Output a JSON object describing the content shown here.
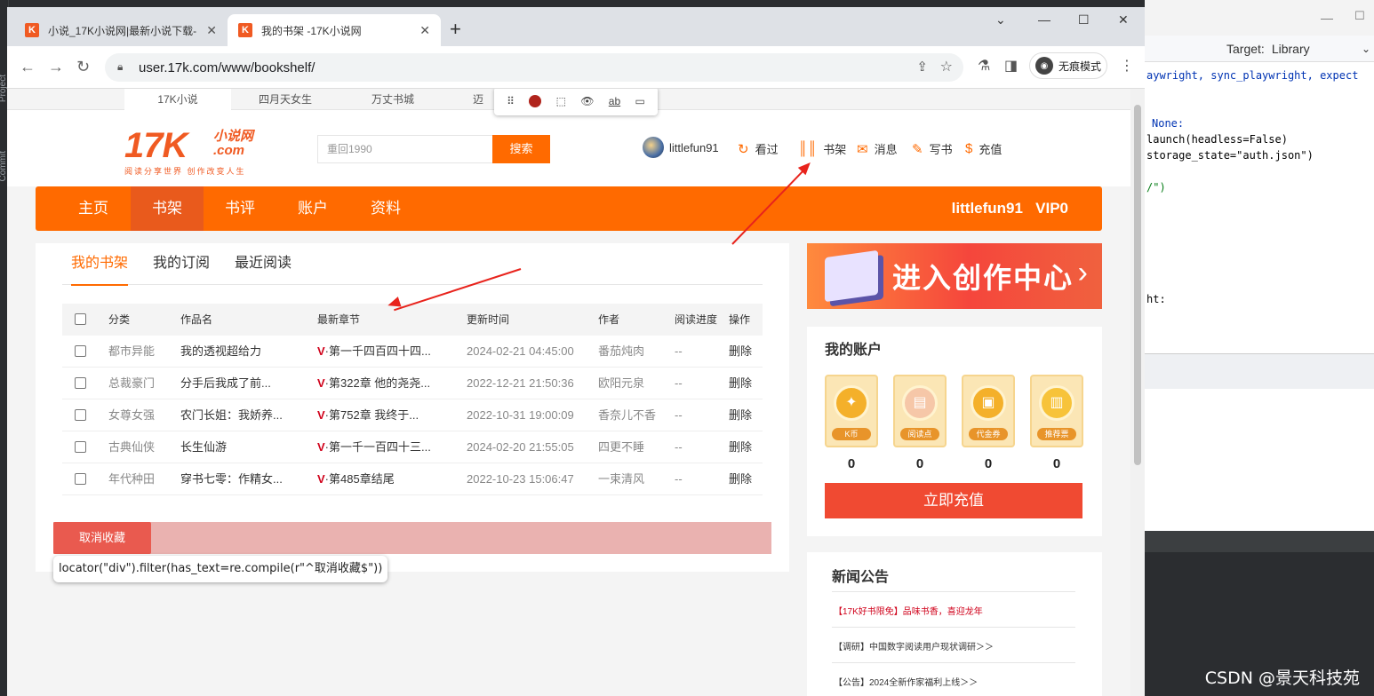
{
  "ide": {
    "left_labels": [
      "Project",
      "Commit"
    ],
    "target_label": "Target:",
    "target_value": "Library",
    "code_lines": [
      {
        "text": "aywright, sync_playwright, expect"
      },
      {
        "text": "None:"
      },
      {
        "text": "launch(headless=False)"
      },
      {
        "text": "storage_state=\"auth.json\")"
      },
      {
        "text": "/\")"
      },
      {
        "text": "ht:"
      }
    ]
  },
  "watermark": "CSDN @景天科技苑",
  "browser": {
    "tabs": [
      {
        "title": "小说_17K小说网|最新小说下载-",
        "favicon": "K"
      },
      {
        "title": "我的书架 -17K小说网",
        "favicon": "K"
      }
    ],
    "url": "user.17k.com/www/bookshelf/",
    "incognito_label": "无痕模式"
  },
  "site_tabs": [
    "17K小说",
    "四月天女生",
    "万丈书城",
    "迈"
  ],
  "playwright_toolbar": {
    "icons": [
      "drag-icon",
      "record-icon",
      "pick-locator-icon",
      "assert-visibility-icon",
      "assert-text-icon",
      "assert-value-icon"
    ]
  },
  "header": {
    "logo_main": "17K",
    "logo_suffix_top": "小说网",
    "logo_suffix_bottom": ".com",
    "slogan": "阅读分享世界 创作改变人生",
    "search_placeholder": "重回1990",
    "search_button": "搜索",
    "username": "littlefun91",
    "links": [
      "看过",
      "书架",
      "消息",
      "写书",
      "充值"
    ]
  },
  "main_nav": {
    "items": [
      "主页",
      "书架",
      "书评",
      "账户",
      "资料"
    ],
    "active": "书架",
    "user": "littlefun91",
    "vip": "VIP0"
  },
  "shelf": {
    "tabs": [
      "我的书架",
      "我的订阅",
      "最近阅读"
    ],
    "active_tab": "我的书架",
    "columns": [
      "分类",
      "作品名",
      "最新章节",
      "更新时间",
      "作者",
      "阅读进度",
      "操作"
    ],
    "rows": [
      {
        "category": "都市异能",
        "title": "我的透视超给力",
        "vtag": "V",
        "chapter": "·第一千四百四十四...",
        "updated": "2024-02-21 04:45:00",
        "author": "番茄炖肉",
        "progress": "--",
        "action": "删除"
      },
      {
        "category": "总裁豪门",
        "title": "分手后我成了前...",
        "vtag": "V",
        "chapter": "·第322章 他的尧尧...",
        "updated": "2022-12-21 21:50:36",
        "author": "欧阳元泉",
        "progress": "--",
        "action": "删除"
      },
      {
        "category": "女尊女强",
        "title": "农门长姐：我娇养...",
        "vtag": "V",
        "chapter": "·第752章 我终于...",
        "updated": "2022-10-31 19:00:09",
        "author": "香奈儿不香",
        "progress": "--",
        "action": "删除"
      },
      {
        "category": "古典仙侠",
        "title": "长生仙游",
        "vtag": "V",
        "chapter": "·第一千一百四十三...",
        "updated": "2024-02-20 21:55:05",
        "author": "四更不睡",
        "progress": "--",
        "action": "删除"
      },
      {
        "category": "年代种田",
        "title": "穿书七零：作精女...",
        "vtag": "V",
        "chapter": "·第485章结尾",
        "updated": "2022-10-23 15:06:47",
        "author": "一束清风",
        "progress": "--",
        "action": "删除"
      }
    ],
    "cancel_button": "取消收藏"
  },
  "locator_tooltip": "locator(\"div\").filter(has_text=re.compile(r\"^取消收藏$\"))",
  "banner_text": "进入创作中心",
  "account": {
    "title": "我的账户",
    "cards": [
      {
        "label": "K币",
        "value": "0"
      },
      {
        "label": "阅读点",
        "value": "0"
      },
      {
        "label": "代金券",
        "value": "0"
      },
      {
        "label": "推荐票",
        "value": "0"
      }
    ],
    "recharge_button": "立即充值"
  },
  "news": {
    "title": "新闻公告",
    "items": [
      {
        "text": "【17K好书限免】品味书香，喜迎龙年",
        "color": "#d0021b"
      },
      {
        "text": "【调研】中国数字阅读用户现状调研＞＞",
        "color": "#333333"
      },
      {
        "text": "【公告】2024全新作家福利上线＞＞",
        "color": "#333333"
      }
    ]
  },
  "colors": {
    "brand": "#ff6a00",
    "annotation_arrow": "#e8231c",
    "recharge": "#f04a32"
  }
}
